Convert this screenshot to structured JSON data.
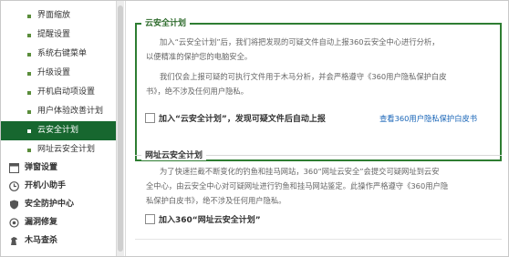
{
  "sidebar": {
    "sub_items": [
      {
        "label": "界面缩放",
        "active": false
      },
      {
        "label": "提醒设置",
        "active": false
      },
      {
        "label": "系统右键菜单",
        "active": false
      },
      {
        "label": "升级设置",
        "active": false
      },
      {
        "label": "开机启动项设置",
        "active": false
      },
      {
        "label": "用户体验改善计划",
        "active": false
      },
      {
        "label": "云安全计划",
        "active": true
      },
      {
        "label": "网址云安全计划",
        "active": false
      }
    ],
    "categories": [
      {
        "label": "弹窗设置",
        "icon": "popup-icon"
      },
      {
        "label": "开机小助手",
        "icon": "clock-icon"
      },
      {
        "label": "安全防护中心",
        "icon": "shield-icon"
      },
      {
        "label": "漏洞修复",
        "icon": "gear-icon"
      },
      {
        "label": "木马查杀",
        "icon": "horse-icon"
      }
    ]
  },
  "cloud_security": {
    "title": "云安全计划",
    "para1_line1": "加入“云安全计划”后，我们将把发现的可疑文件自动上报360云安全中心进行分析，",
    "para1_line2": "以便精准的保护您的电脑安全。",
    "para2_line1": "我们仅会上报可疑的可执行文件用于木马分析，并会严格遵守《360用户隐私保护白皮",
    "para2_line2": "书》，绝不涉及任何用户隐私。",
    "checkbox_label": "加入“云安全计划”，发现可疑文件后自动上报",
    "checkbox_checked": false,
    "privacy_link": "查看360用户隐私保护白皮书"
  },
  "url_security": {
    "title": "网址云安全计划",
    "para_line1": "为了快速拦截不断变化的钓鱼和挂马网站，360“网址云安全”会提交可疑网址到云安",
    "para_line2": "全中心，由云安全中心对可疑网址进行钓鱼和挂马网站鉴定。此操作严格遵守《360用户隐",
    "para_line3": "私保护白皮书》，绝不涉及任何用户隐私。",
    "checkbox_label": "加入360“网址云安全计划”",
    "checkbox_checked": false
  },
  "colors": {
    "active_bg": "#17672f",
    "panel_border": "#2e7d32",
    "link": "#1a66b8"
  }
}
